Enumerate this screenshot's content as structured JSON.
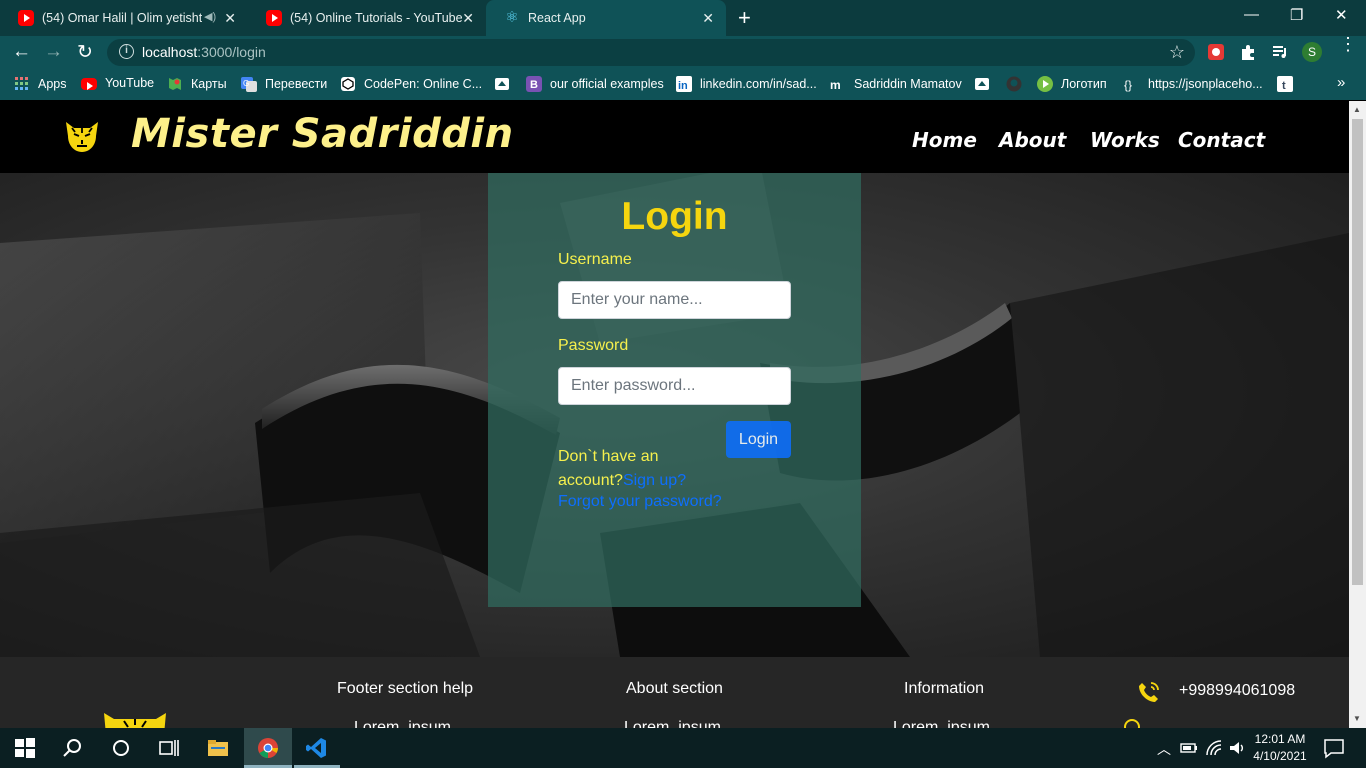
{
  "browser": {
    "tabs": [
      {
        "title": "(54) Omar Halil | Olim yetisht",
        "favicon": "youtube-icon",
        "audio": true
      },
      {
        "title": "(54) Online Tutorials - YouTube",
        "favicon": "youtube-icon"
      },
      {
        "title": "React App",
        "favicon": "react-icon",
        "active": true
      }
    ],
    "url_host": "localhost",
    "url_rest": ":3000/login",
    "profile_initial": "S",
    "bookmarks": [
      {
        "label": "Apps",
        "icon": "apps-grid-icon"
      },
      {
        "label": "YouTube",
        "icon": "youtube-icon"
      },
      {
        "label": "Карты",
        "icon": "maps-icon"
      },
      {
        "label": "Перевести",
        "icon": "translate-icon"
      },
      {
        "label": "CodePen: Online C...",
        "icon": "codepen-icon"
      },
      {
        "label": "",
        "icon": "bookmark-icon"
      },
      {
        "label": "our official examples",
        "icon": "bootstrap-icon"
      },
      {
        "label": "linkedin.com/in/sad...",
        "icon": "linkedin-icon"
      },
      {
        "label": "Sadriddin Mamatov",
        "icon": "mm-icon"
      },
      {
        "label": "",
        "icon": "bookmark-icon"
      },
      {
        "label": "",
        "icon": "github-icon"
      },
      {
        "label": "Логотип",
        "icon": "play-icon"
      },
      {
        "label": "https://jsonplaceho...",
        "icon": "globe-icon"
      },
      {
        "label": "",
        "icon": "tumblr-icon"
      }
    ]
  },
  "site": {
    "brand": "Mister Sadriddin",
    "nav": [
      "Home",
      "About",
      "Works",
      "Contact"
    ],
    "accent": "#f5d50f"
  },
  "login": {
    "title": "Login",
    "username_label": "Username",
    "username_placeholder": "Enter your name...",
    "password_label": "Password",
    "password_placeholder": "Enter password...",
    "button": "Login",
    "no_account": "Don`t have an account?",
    "signup_link": "Sign up?",
    "forgot_link": "Forgot your password?"
  },
  "footer": {
    "col1": "Footer section help",
    "col2": "About section",
    "col3": "Information",
    "sub1": "Lorem, ipsum",
    "sub2": "Lorem, ipsum",
    "sub3": "Lorem, ipsum",
    "phone": "+998994061098"
  },
  "taskbar": {
    "time": "12:01 AM",
    "date": "4/10/2021"
  }
}
